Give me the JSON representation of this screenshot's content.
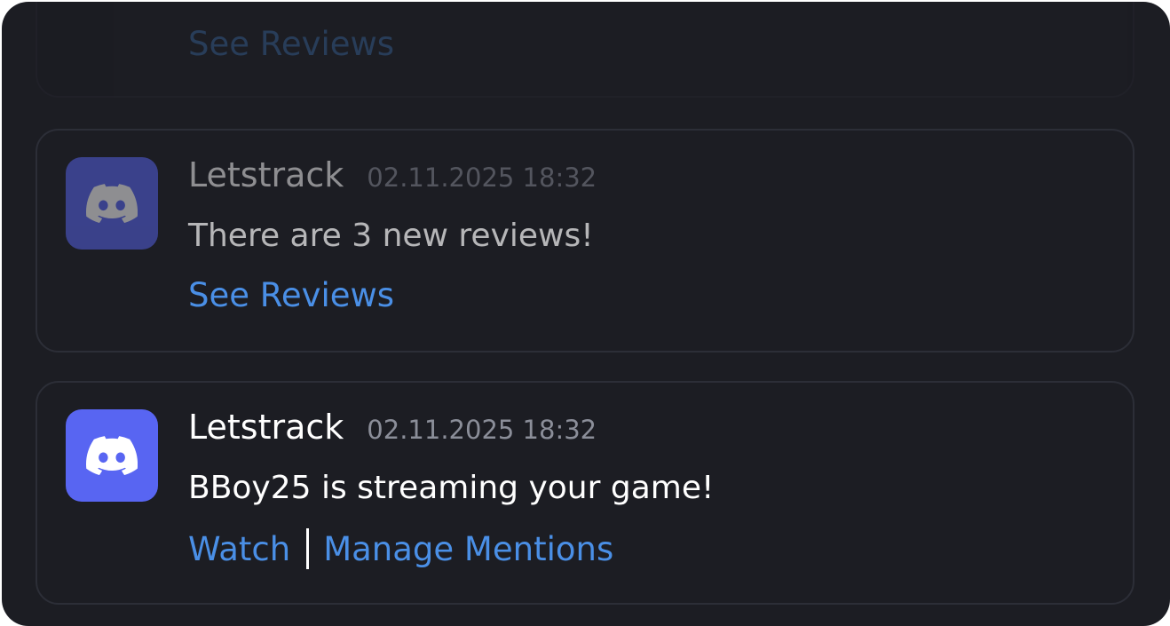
{
  "notifications": [
    {
      "actions": [
        "See Reviews"
      ]
    },
    {
      "sender": "Letstrack",
      "timestamp": "02.11.2025 18:32",
      "message": "There are 3 new reviews!",
      "actions": [
        "See Reviews"
      ]
    },
    {
      "sender": "Letstrack",
      "timestamp": "02.11.2025 18:32",
      "message": "BBoy25 is streaming your game!",
      "actions": [
        "Watch",
        "Manage Mentions"
      ]
    }
  ],
  "icons": {
    "avatar": "discord-icon"
  },
  "colors": {
    "background": "#1c1d23",
    "card_border": "#2c2e37",
    "avatar": "#5865f2",
    "link": "#4a8fe6",
    "timestamp": "#8b8e99"
  }
}
